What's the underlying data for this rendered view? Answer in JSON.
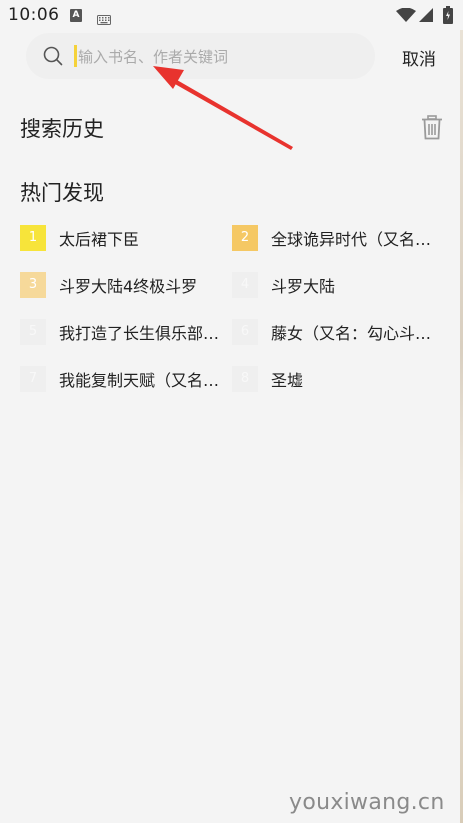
{
  "status_bar": {
    "time": "10:06",
    "app_badge": "A",
    "icons": [
      "a-icon",
      "keyboard-icon",
      "wifi-icon",
      "signal-icon",
      "battery-icon"
    ]
  },
  "search": {
    "placeholder": "输入书名、作者关键词",
    "value": "",
    "cancel_label": "取消"
  },
  "history": {
    "title": "搜索历史",
    "clear_icon": "trash-icon"
  },
  "hot": {
    "title": "热门发现",
    "items": [
      {
        "rank": "1",
        "name": "太后裙下臣",
        "badge_color": "#f7e43a"
      },
      {
        "rank": "2",
        "name": "全球诡异时代（又名…",
        "badge_color": "#f5c864"
      },
      {
        "rank": "3",
        "name": "斗罗大陆4终极斗罗",
        "badge_color": "#f6d99a"
      },
      {
        "rank": "4",
        "name": "斗罗大陆",
        "badge_color": "#efefef"
      },
      {
        "rank": "5",
        "name": "我打造了长生俱乐部…",
        "badge_color": "#efefef"
      },
      {
        "rank": "6",
        "name": "藤女（又名：勾心斗…",
        "badge_color": "#efefef"
      },
      {
        "rank": "7",
        "name": "我能复制天赋（又名…",
        "badge_color": "#efefef"
      },
      {
        "rank": "8",
        "name": "圣墟",
        "badge_color": "#efefef"
      }
    ]
  },
  "watermark": "youxiwang.cn",
  "colors": {
    "background": "#f4f4f4",
    "arrow": "#e8332e",
    "cursor": "#f5d23a"
  }
}
